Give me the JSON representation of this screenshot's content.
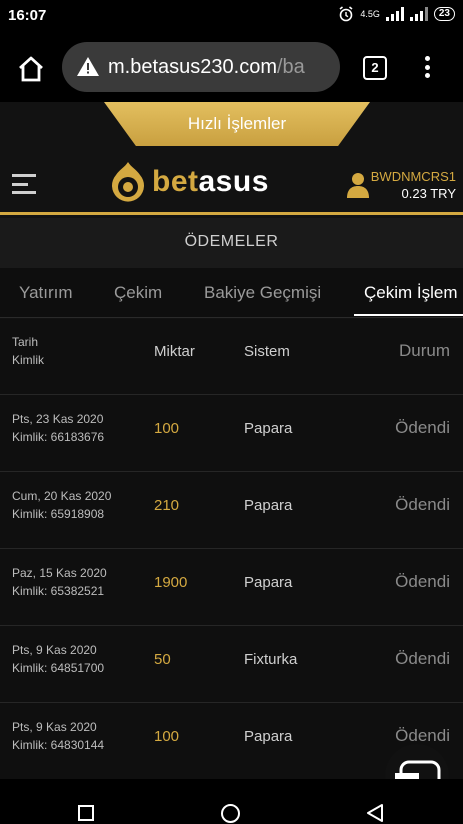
{
  "status_bar": {
    "time": "16:07",
    "network_label": "4.5G",
    "battery": "23"
  },
  "browser": {
    "url_host": "m.betasus230.com",
    "url_path": "/ba",
    "tab_count": "2"
  },
  "quick_actions": {
    "label": "Hızlı İşlemler"
  },
  "header": {
    "brand_gold": "bet",
    "brand_white": "asus",
    "username": "BWDNMCRS1",
    "balance": "0.23 TRY",
    "accent_color": "#d4a941"
  },
  "section": {
    "title": "ÖDEMELER"
  },
  "tabs": [
    {
      "label": "Yatırım"
    },
    {
      "label": "Çekim"
    },
    {
      "label": "Bakiye Geçmişi"
    },
    {
      "label": "Çekim İşlem"
    }
  ],
  "table": {
    "headers": {
      "date": "Tarih",
      "id": "Kimlik",
      "amount": "Miktar",
      "system": "Sistem",
      "status": "Durum"
    },
    "rows": [
      {
        "date": "Pts, 23 Kas 2020",
        "id": "Kimlik: 66183676",
        "amount": "100",
        "system": "Papara",
        "status": "Ödendi"
      },
      {
        "date": "Cum, 20 Kas 2020",
        "id": "Kimlik: 65918908",
        "amount": "210",
        "system": "Papara",
        "status": "Ödendi"
      },
      {
        "date": "Paz, 15 Kas 2020",
        "id": "Kimlik: 65382521",
        "amount": "1900",
        "system": "Papara",
        "status": "Ödendi"
      },
      {
        "date": "Pts, 9 Kas 2020",
        "id": "Kimlik: 64851700",
        "amount": "50",
        "system": "Fixturka",
        "status": "Ödendi"
      },
      {
        "date": "Pts, 9 Kas 2020",
        "id": "Kimlik: 64830144",
        "amount": "100",
        "system": "Papara",
        "status": "Ödendi"
      }
    ]
  },
  "icons": [
    "home-icon",
    "warning-icon",
    "menu-icon",
    "user-icon",
    "chat-icon",
    "alarm-icon",
    "signal-icon"
  ]
}
